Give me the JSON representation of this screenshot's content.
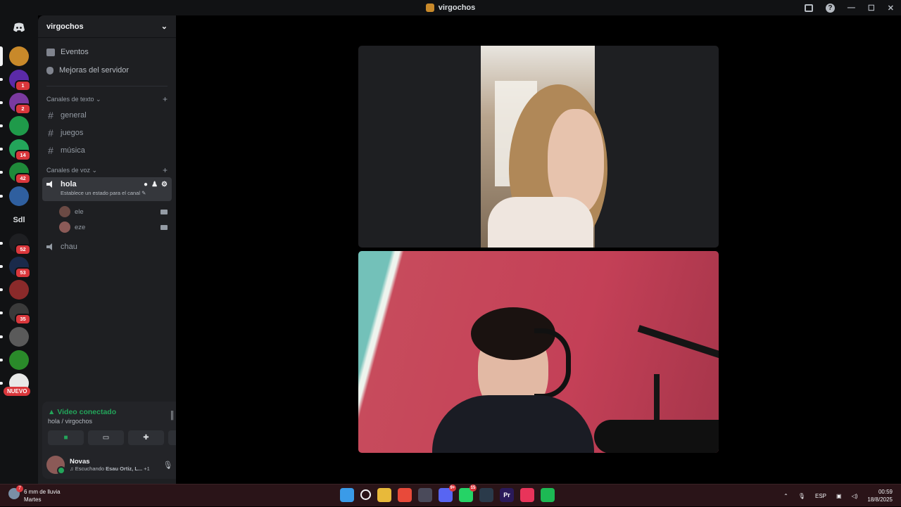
{
  "window": {
    "title": "virgochos"
  },
  "rail": {
    "servers": [
      {
        "name": "server-1",
        "color": "#c8892a",
        "badge": ""
      },
      {
        "name": "server-2",
        "color": "#5b2aa8",
        "badge": "1"
      },
      {
        "name": "server-3",
        "color": "#7a3aa0",
        "badge": "2"
      },
      {
        "name": "server-4",
        "color": "#1f9a4a",
        "badge": ""
      },
      {
        "name": "server-5",
        "color": "#23a55a",
        "badge": "14"
      },
      {
        "name": "server-6",
        "color": "#1f8a3a",
        "badge": "42"
      },
      {
        "name": "server-7",
        "color": "#2f5f9f",
        "badge": ""
      },
      {
        "name": "server-8",
        "color": "#1e1f22",
        "badge": "52"
      },
      {
        "name": "server-9",
        "color": "#1a2a4a",
        "badge": "53"
      },
      {
        "name": "server-10",
        "color": "#8a2a2a",
        "badge": ""
      },
      {
        "name": "server-11",
        "color": "#3a3a3a",
        "badge": "35"
      },
      {
        "name": "server-12",
        "color": "#5a5a5a",
        "badge": ""
      },
      {
        "name": "server-13",
        "color": "#2a8a2a",
        "badge": ""
      },
      {
        "name": "server-14",
        "color": "#e8e8e8",
        "badge": ""
      }
    ],
    "text_server": "Sdl",
    "new_label": "NUEVO"
  },
  "sidebar": {
    "server_name": "virgochos",
    "items": [
      {
        "label": "Eventos"
      },
      {
        "label": "Mejoras del servidor"
      }
    ],
    "text_category": "Canales de texto",
    "text_channels": [
      "general",
      "juegos",
      "música"
    ],
    "voice_category": "Canales de voz",
    "active_voice": {
      "name": "hola",
      "status": "Establece un estado para el canal"
    },
    "voice_users": [
      "ele",
      "eze"
    ],
    "other_voice": "chau"
  },
  "panel": {
    "title": "Video conectado",
    "subtitle": "hola / virgochos",
    "user_name": "Novas",
    "activity_prefix": "Escuchando",
    "activity_artist": "Esau Ortiz, L...",
    "activity_extra": "+1"
  },
  "taskbar": {
    "weather_line1": "6 mm de lluvia",
    "weather_line2": "Martes",
    "weather_badge": "7",
    "apps": [
      {
        "name": "windows",
        "color": "#3a9be8",
        "badge": "",
        "text": ""
      },
      {
        "name": "search",
        "color": "transparent",
        "badge": "",
        "text": ""
      },
      {
        "name": "files",
        "color": "#e8b93a",
        "badge": "",
        "text": ""
      },
      {
        "name": "chrome",
        "color": "#e84a3a",
        "badge": "",
        "text": ""
      },
      {
        "name": "store",
        "color": "#4a4a5a",
        "badge": "",
        "text": ""
      },
      {
        "name": "discord",
        "color": "#5865f2",
        "badge": "9+",
        "text": ""
      },
      {
        "name": "whatsapp",
        "color": "#25d366",
        "badge": "15",
        "text": ""
      },
      {
        "name": "steam",
        "color": "#2a3a4a",
        "badge": "",
        "text": ""
      },
      {
        "name": "premiere",
        "color": "#2a1a5a",
        "badge": "",
        "text": "Pr"
      },
      {
        "name": "tiktok",
        "color": "#e8345a",
        "badge": "",
        "text": ""
      },
      {
        "name": "spotify",
        "color": "#1db954",
        "badge": "",
        "text": ""
      }
    ],
    "lang": "ESP",
    "time": "00:59",
    "date": "18/8/2025"
  }
}
